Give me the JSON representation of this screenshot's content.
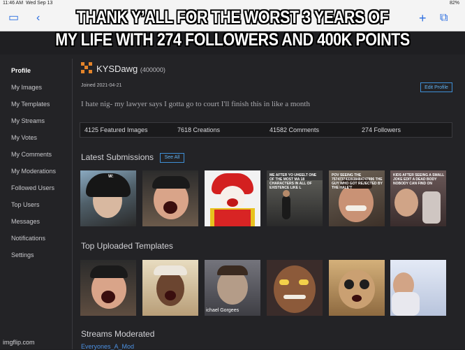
{
  "status": {
    "time": "11:46 AM",
    "date": "Wed Sep 13",
    "battery": "82%"
  },
  "caption": {
    "line1": "THANK Y’ALL FOR THE WORST 3 YEARS OF",
    "line2": "MY LIFE  WITH 274 FOLLOWERS AND 400K POINTS"
  },
  "sidebar": {
    "items": [
      {
        "label": "Profile"
      },
      {
        "label": "My Images"
      },
      {
        "label": "My Templates"
      },
      {
        "label": "My Streams"
      },
      {
        "label": "My Votes"
      },
      {
        "label": "My Comments"
      },
      {
        "label": "My Moderations"
      },
      {
        "label": "Followed Users"
      },
      {
        "label": "Top Users"
      },
      {
        "label": "Messages"
      },
      {
        "label": "Notifications"
      },
      {
        "label": "Settings"
      }
    ]
  },
  "profile": {
    "username": "KYSDawg",
    "points": "(400000)",
    "joined": "Joined 2021-04-21",
    "edit_label": "Edit Profile",
    "bio": "I hate nig- my lawyer says I gotta go to court I'll finish this in like a month"
  },
  "stats": {
    "featured": "4125 Featured Images",
    "creations": "7618 Creations",
    "comments": "41582 Comments",
    "followers": "274 Followers"
  },
  "latest": {
    "title": "Latest Submissions",
    "see_all": "See All",
    "thumb1_text": "W:",
    "thumb4_text": "ME AFTER YO UHEELT ONE OF THE MOST MA 18 CHARACTERS IN ALL OF EXISTENCE LIKE L",
    "thumb5_text": "POV SEEING THE 7574737433938484747896 THE GUY WHO GOT REJECTED BY THE HALE'T",
    "thumb6_text": "KIDS AFTER SEEING A SMALL JOKE EDIT A DEAD BODY NOBODY CAN FIND ON"
  },
  "templates": {
    "title": "Top Uploaded Templates",
    "thumb3_text": "ichael Gorgees"
  },
  "streams": {
    "title": "Streams Moderated",
    "link": "Everyones_A_Mod"
  },
  "watermark": "imgflip.com",
  "colors": {
    "accent": "#3f8fd6",
    "logo": "#e4842a",
    "background": "#232326"
  }
}
